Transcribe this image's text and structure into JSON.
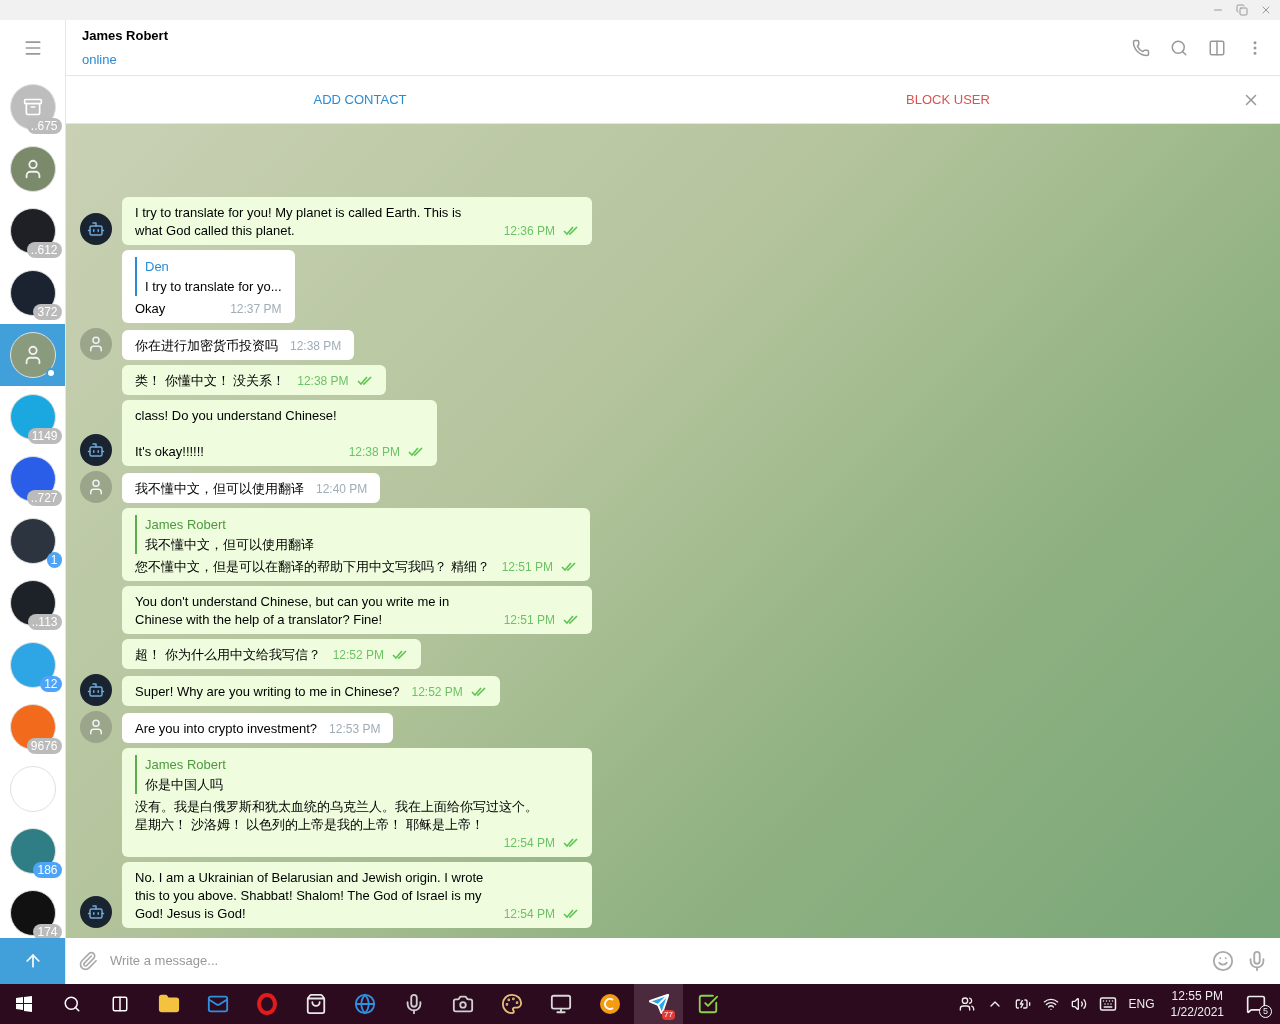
{
  "chat_list": [
    {
      "color": "#bdbdbd",
      "badge": "..675",
      "muted": true,
      "selected": false,
      "online": false,
      "kind": "archive"
    },
    {
      "color": "#7a8a6a",
      "selected": false,
      "online": false,
      "kind": "photo"
    },
    {
      "color": "#1e2026",
      "badge": "..612",
      "muted": true,
      "selected": false,
      "online": false,
      "kind": "logo"
    },
    {
      "color": "#1b2330",
      "badge": "372",
      "muted": true,
      "selected": false,
      "online": false,
      "kind": "logo"
    },
    {
      "color": "#8a9a7c",
      "selected": true,
      "online": true,
      "kind": "photo"
    },
    {
      "color": "#1ba8e0",
      "badge": "1149",
      "muted": true,
      "selected": false,
      "online": false,
      "kind": "logo"
    },
    {
      "color": "#2a5ee8",
      "badge": "..727",
      "muted": true,
      "selected": false,
      "online": false,
      "kind": "logo"
    },
    {
      "color": "#2c3440",
      "badge": "1",
      "muted": false,
      "selected": false,
      "online": false,
      "kind": "logo"
    },
    {
      "color": "#1d2128",
      "badge": "..113",
      "muted": true,
      "selected": false,
      "online": false,
      "kind": "logo"
    },
    {
      "color": "#2ea6e6",
      "badge": "12",
      "muted": false,
      "selected": false,
      "online": false,
      "kind": "logo"
    },
    {
      "color": "#f26a1b",
      "badge": "9676",
      "muted": true,
      "selected": false,
      "online": false,
      "kind": "logo"
    },
    {
      "color": "#ffffff",
      "selected": false,
      "online": false,
      "kind": "logo"
    },
    {
      "color": "#2f7e86",
      "badge": "186",
      "muted": false,
      "selected": false,
      "online": false,
      "kind": "logo"
    },
    {
      "color": "#111111",
      "badge": "174",
      "muted": true,
      "selected": false,
      "online": false,
      "kind": "logo"
    }
  ],
  "header": {
    "name": "James Robert",
    "status": "online"
  },
  "action_bar": {
    "add": "ADD CONTACT",
    "block": "BLOCK USER"
  },
  "messages": [
    {
      "outgoing": true,
      "text": "I try to translate for you! My planet is called Earth. This is what God called this planet.",
      "time": "12:36 PM",
      "read": true
    },
    {
      "outgoing": false,
      "reply": {
        "name": "Den",
        "text": "I try to translate for yo..."
      },
      "text": "Okay",
      "time": "12:37 PM"
    },
    {
      "outgoing": false,
      "text": "你在进行加密货币投资吗",
      "time": "12:38 PM"
    },
    {
      "outgoing": true,
      "text": "类！ 你懂中文！ 没关系！",
      "time": "12:38 PM",
      "read": true
    },
    {
      "outgoing": true,
      "text": "class! Do you understand Chinese!\n\nIt's okay!!!!!!",
      "time": "12:38 PM",
      "read": true
    },
    {
      "outgoing": false,
      "text": "我不懂中文，但可以使用翻译",
      "time": "12:40 PM"
    },
    {
      "outgoing": true,
      "reply": {
        "name": "James Robert",
        "text": "我不懂中文，但可以使用翻译"
      },
      "text": "您不懂中文，但是可以在翻译的帮助下用中文写我吗？ 精细？",
      "time": "12:51 PM",
      "read": true
    },
    {
      "outgoing": true,
      "text": "You don't understand Chinese, but can you write me in Chinese with the help of a translator? Fine!",
      "time": "12:51 PM",
      "read": true
    },
    {
      "outgoing": true,
      "text": "超！ 你为什么用中文给我写信？",
      "time": "12:52 PM",
      "read": true
    },
    {
      "outgoing": true,
      "text": "Super! Why are you writing to me in Chinese?",
      "time": "12:52 PM",
      "read": true
    },
    {
      "outgoing": false,
      "text": "Are you into crypto investment?",
      "time": "12:53 PM"
    },
    {
      "outgoing": true,
      "reply": {
        "name": "James Robert",
        "text": "你是中国人吗"
      },
      "lines": [
        "没有。我是白俄罗斯和犹太血统的乌克兰人。我在上面给你写过这个。",
        "星期六！ 沙洛姆！ 以色列的上帝是我的上帝！ 耶稣是上帝！"
      ],
      "time": "12:54 PM",
      "read": true
    },
    {
      "outgoing": true,
      "text": "No. I am a Ukrainian of Belarusian and Jewish origin. I wrote this to you above. Shabbat! Shalom! The God of Israel is my God! Jesus is God!",
      "time": "12:54 PM",
      "read": true
    }
  ],
  "composer": {
    "placeholder": "Write a message..."
  },
  "taskbar": {
    "apps": [
      {
        "kind": "folder",
        "active": false
      },
      {
        "kind": "mail",
        "active": false
      },
      {
        "kind": "opera",
        "active": false
      },
      {
        "kind": "store",
        "active": false
      },
      {
        "kind": "edge",
        "active": false
      },
      {
        "kind": "mic",
        "active": false
      },
      {
        "kind": "camera",
        "active": false
      },
      {
        "kind": "paint",
        "active": false
      },
      {
        "kind": "monitor",
        "active": false
      },
      {
        "kind": "coin",
        "active": false
      },
      {
        "kind": "telegram",
        "active": true,
        "badge": "77"
      },
      {
        "kind": "check",
        "active": false
      }
    ],
    "language": "ENG",
    "time": "12:55 PM",
    "date": "1/22/2021",
    "notifications": "5"
  }
}
